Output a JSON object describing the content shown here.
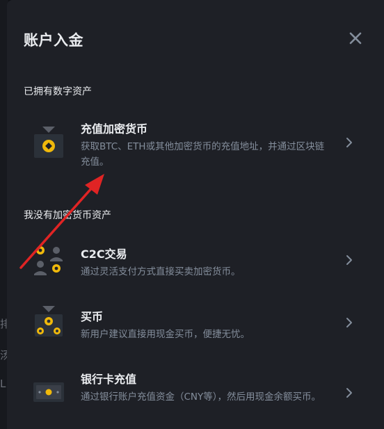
{
  "modal": {
    "title": "账户入金",
    "close_icon": "close-icon"
  },
  "sections": {
    "have_crypto": "已拥有数字资产",
    "no_crypto": "我没有加密货币资产"
  },
  "options": [
    {
      "title": "充值加密货币",
      "desc": "获取BTC、ETH或其他加密货币的充值地址，并通过区块链充值。",
      "icon": "wallet-deposit-icon"
    },
    {
      "title": "C2C交易",
      "desc": "通过灵活支付方式直接买卖加密货币。",
      "icon": "p2p-users-icon"
    },
    {
      "title": "买币",
      "desc": "新用户建议直接用现金买币，便捷无忧。",
      "icon": "buy-coin-icon"
    },
    {
      "title": "银行卡充值",
      "desc": "通过银行账户充值资金（CNY等），然后用现金余额买币。",
      "icon": "bank-card-icon"
    }
  ],
  "background": {
    "glyphs": [
      "排",
      "汤",
      "L"
    ]
  },
  "colors": {
    "accent": "#f0b90b",
    "annotation_arrow": "#e02424",
    "modal_bg": "#1e2026",
    "text_primary": "#eaecef",
    "text_secondary": "#848e9c"
  }
}
